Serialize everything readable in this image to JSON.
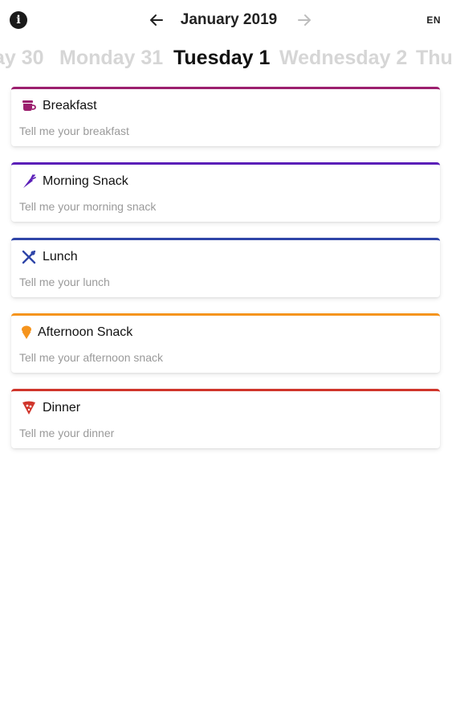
{
  "header": {
    "month_label": "January 2019",
    "lang_label": "EN",
    "icons": {
      "info": "info-icon",
      "prev": "arrow-left-icon",
      "next": "arrow-right-icon"
    }
  },
  "days": [
    {
      "label": "ay 30",
      "active": false
    },
    {
      "label": "Monday 31",
      "active": false
    },
    {
      "label": "Tuesday 1",
      "active": true
    },
    {
      "label": "Wednesday 2",
      "active": false
    },
    {
      "label": "Thu",
      "active": false
    }
  ],
  "meals": [
    {
      "title": "Breakfast",
      "hint": "Tell me your breakfast",
      "icon": "coffee-cup-icon",
      "color": "#9c1f6e"
    },
    {
      "title": "Morning Snack",
      "hint": "Tell me your morning snack",
      "icon": "carrot-icon",
      "color": "#5b1fb8"
    },
    {
      "title": "Lunch",
      "hint": "Tell me your lunch",
      "icon": "fork-knife-icon",
      "color": "#2f45a8"
    },
    {
      "title": "Afternoon Snack",
      "hint": "Tell me your afternoon snack",
      "icon": "ice-cream-icon",
      "color": "#f5941d"
    },
    {
      "title": "Dinner",
      "hint": "Tell me your dinner",
      "icon": "pizza-icon",
      "color": "#d0352b"
    }
  ]
}
